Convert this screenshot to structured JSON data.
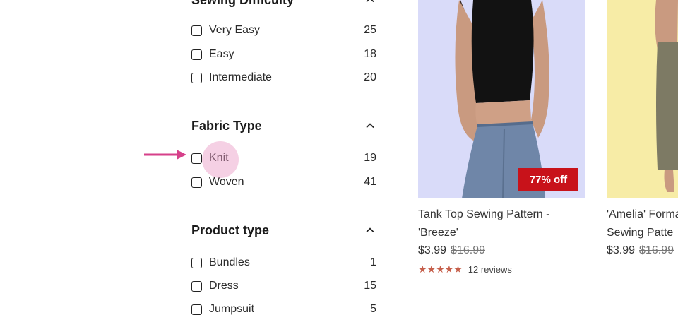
{
  "filters": {
    "sewing_difficulty": {
      "title": "Sewing Difficulty",
      "options": [
        {
          "label": "Very Easy",
          "count": "25"
        },
        {
          "label": "Easy",
          "count": "18"
        },
        {
          "label": "Intermediate",
          "count": "20"
        }
      ]
    },
    "fabric_type": {
      "title": "Fabric Type",
      "options": [
        {
          "label": "Knit",
          "count": "19"
        },
        {
          "label": "Woven",
          "count": "41"
        }
      ]
    },
    "product_type": {
      "title": "Product type",
      "options": [
        {
          "label": "Bundles",
          "count": "1"
        },
        {
          "label": "Dress",
          "count": "15"
        },
        {
          "label": "Jumpsuit",
          "count": "5"
        }
      ]
    }
  },
  "products": [
    {
      "title": "Tank Top Sewing Pattern - 'Breeze'",
      "price": "$3.99",
      "old_price": "$16.99",
      "badge": "77% off",
      "stars": "★★★★★",
      "reviews": "12 reviews"
    },
    {
      "title_line1": "'Amelia' Forma",
      "title_line2": "Sewing Patte",
      "price": "$3.99",
      "old_price": "$16.99"
    }
  ],
  "colors": {
    "badge_red": "#c8121a",
    "star": "#c65f4b",
    "highlight_pink": "#e996c3",
    "arrow_pink": "#d6408a",
    "card1_bg": "#d9dbf9",
    "card2_bg": "#f7eca6"
  },
  "icons": {
    "chevron": "chevron-up-icon",
    "arrow": "arrow-right-icon"
  }
}
